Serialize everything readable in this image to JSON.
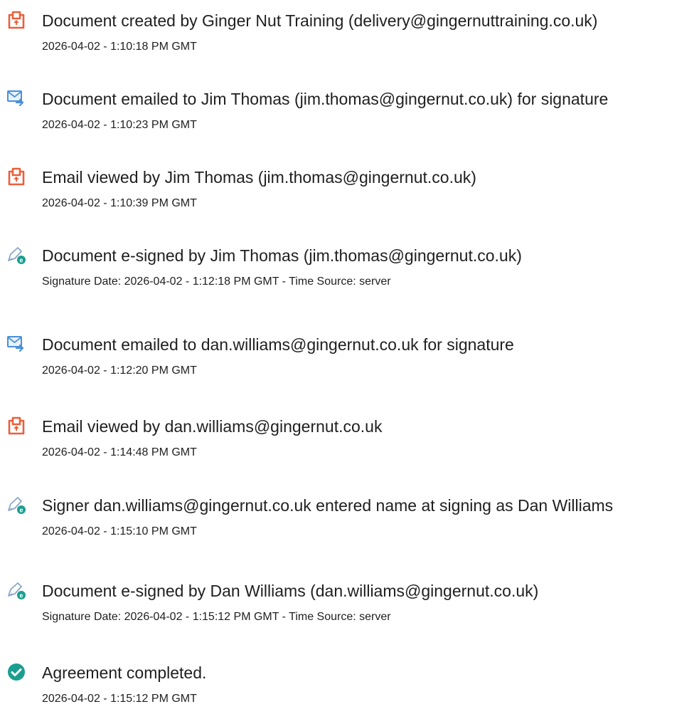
{
  "events": [
    {
      "icon": "document-created-icon",
      "title": "Document created by Ginger Nut Training (delivery@gingernuttraining.co.uk)",
      "meta": "2026-04-02 - 1:10:18 PM GMT"
    },
    {
      "icon": "email-sent-icon",
      "title": "Document emailed to Jim Thomas (jim.thomas@gingernut.co.uk) for signature",
      "meta": "2026-04-02 - 1:10:23 PM GMT"
    },
    {
      "icon": "email-viewed-icon",
      "title": "Email viewed by Jim Thomas (jim.thomas@gingernut.co.uk)",
      "meta": "2026-04-02 - 1:10:39 PM GMT"
    },
    {
      "icon": "e-sign-icon",
      "title": "Document e-signed by Jim Thomas (jim.thomas@gingernut.co.uk)",
      "meta": "Signature Date: 2026-04-02 - 1:12:18 PM GMT - Time Source: server"
    },
    {
      "icon": "email-sent-icon",
      "title": "Document emailed to dan.williams@gingernut.co.uk for signature",
      "meta": "2026-04-02 - 1:12:20 PM GMT"
    },
    {
      "icon": "email-viewed-icon",
      "title": "Email viewed by dan.williams@gingernut.co.uk",
      "meta": "2026-04-02 - 1:14:48 PM GMT"
    },
    {
      "icon": "e-sign-icon",
      "title": "Signer dan.williams@gingernut.co.uk entered name at signing as Dan Williams",
      "meta": "2026-04-02 - 1:15:10 PM GMT"
    },
    {
      "icon": "e-sign-icon",
      "title": "Document e-signed by Dan Williams (dan.williams@gingernut.co.uk)",
      "meta": "Signature Date: 2026-04-02 - 1:15:12 PM GMT - Time Source: server"
    },
    {
      "icon": "completed-check-icon",
      "title": "Agreement completed.",
      "meta": "2026-04-02 - 1:15:12 PM GMT"
    }
  ],
  "colors": {
    "document_icon": "#e8603c",
    "email_icon": "#4a90d9",
    "sign_icon": "#1a9e8f",
    "check_icon": "#1a9e8f"
  }
}
